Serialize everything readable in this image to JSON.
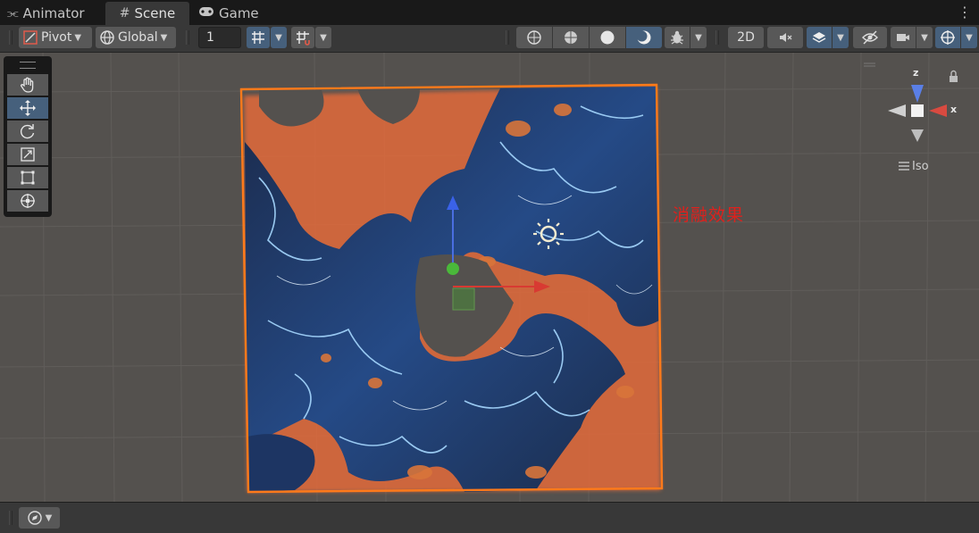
{
  "tabs": [
    {
      "label": "Animator",
      "icon": "animator-icon"
    },
    {
      "label": "Scene",
      "icon": "grid-icon"
    },
    {
      "label": "Game",
      "icon": "gamepad-icon"
    }
  ],
  "toolbar": {
    "pivot_label": "Pivot",
    "global_label": "Global",
    "grid_size_value": "1",
    "two_d_label": "2D"
  },
  "tools": [
    {
      "name": "hand-tool",
      "icon": "hand-icon"
    },
    {
      "name": "move-tool",
      "icon": "move-icon",
      "active": true
    },
    {
      "name": "rotate-tool",
      "icon": "rotate-icon"
    },
    {
      "name": "scale-tool",
      "icon": "scale-icon"
    },
    {
      "name": "rect-tool",
      "icon": "rect-icon"
    },
    {
      "name": "transform-tool",
      "icon": "transform-icon"
    }
  ],
  "scene": {
    "annotation": "消融效果"
  },
  "gizmo": {
    "axis_z": "z",
    "axis_x": "x",
    "projection_label": "Iso"
  },
  "colors": {
    "selection_outline": "#ff7a1a",
    "active_button": "#46607c",
    "annotation": "#e0201c"
  }
}
